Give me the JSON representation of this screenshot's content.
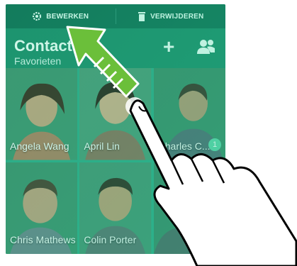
{
  "toolbar": {
    "edit_label": "BEWERKEN",
    "delete_label": "VERWIJDEREN",
    "edit_icon": "gear-icon",
    "delete_icon": "trash-icon"
  },
  "header": {
    "title": "Contacten",
    "subtitle": "Favorieten",
    "add_icon": "plus-icon",
    "group_icon": "people-icon"
  },
  "favorites": [
    {
      "name": "Angela Wang",
      "badge": ""
    },
    {
      "name": "April Lin",
      "badge": ""
    },
    {
      "name": "Charles C...",
      "badge": "1"
    },
    {
      "name": "Chris Mathews",
      "badge": ""
    },
    {
      "name": "Colin Porter",
      "badge": ""
    },
    {
      "name": "",
      "badge": ""
    }
  ],
  "gesture": {
    "arrow_icon": "drag-arrow-icon",
    "hand_icon": "pointing-hand-icon"
  },
  "colors": {
    "accent": "#1b8a67",
    "toolbar": "#0f6e52",
    "arrow": "#6bbf3a"
  }
}
